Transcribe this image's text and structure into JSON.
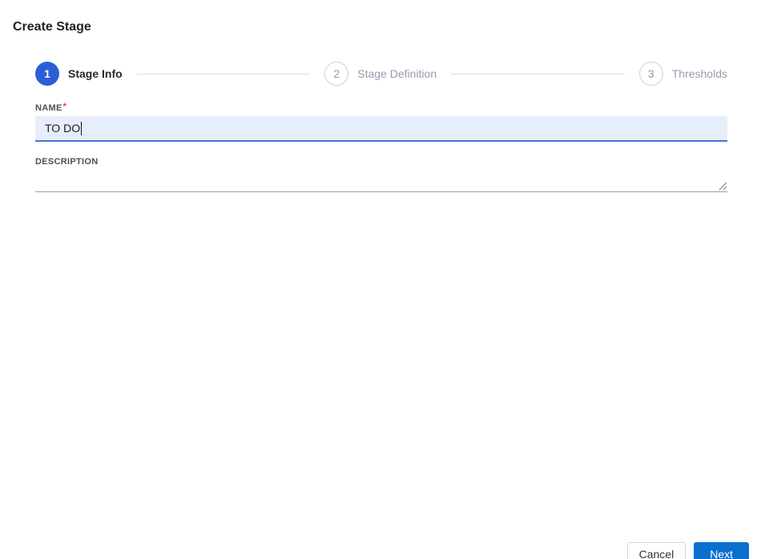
{
  "window": {
    "title": "Create Stage"
  },
  "stepper": {
    "active_step": 1,
    "steps": [
      {
        "number": "1",
        "label": "Stage Info"
      },
      {
        "number": "2",
        "label": "Stage Definition"
      },
      {
        "number": "3",
        "label": "Thresholds"
      }
    ]
  },
  "form": {
    "name": {
      "label": "NAME",
      "required_marker": "*",
      "value": "TO DO"
    },
    "description": {
      "label": "DESCRIPTION",
      "value": ""
    }
  },
  "footer": {
    "cancel_label": "Cancel",
    "next_label": "Next"
  },
  "colors": {
    "active_step_blue": "#2b5dd7",
    "primary_button_blue": "#0b6fce",
    "input_focus_bg": "#e7eefb",
    "input_focus_underline": "#4273d9",
    "required_red": "#e5382e",
    "inactive_step_gray": "#979cae"
  }
}
